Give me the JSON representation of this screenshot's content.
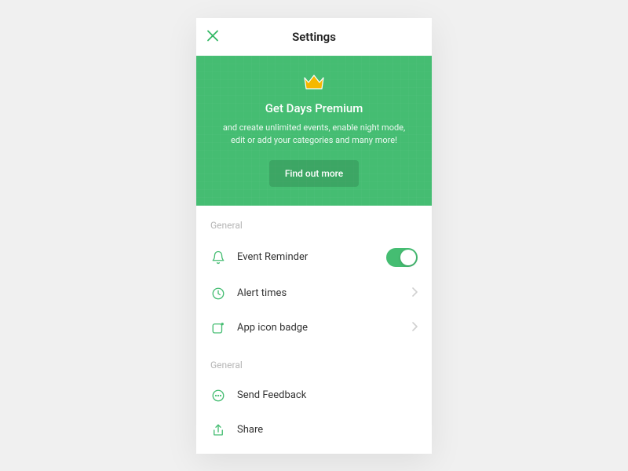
{
  "header": {
    "title": "Settings"
  },
  "premium": {
    "title": "Get Days Premium",
    "description": "and create unlimited events, enable night mode, edit or add your categories and many more!",
    "button": "Find out more"
  },
  "sections": [
    {
      "label": "General",
      "items": [
        {
          "icon": "bell",
          "label": "Event Reminder",
          "accessory": "toggle",
          "toggle_on": true
        },
        {
          "icon": "clock",
          "label": "Alert times",
          "accessory": "chevron"
        },
        {
          "icon": "badge",
          "label": "App icon badge",
          "accessory": "chevron"
        }
      ]
    },
    {
      "label": "General",
      "items": [
        {
          "icon": "chat",
          "label": "Send Feedback",
          "accessory": "none"
        },
        {
          "icon": "share",
          "label": "Share",
          "accessory": "none"
        }
      ]
    }
  ],
  "colors": {
    "accent": "#45bd72",
    "crown_fill": "#f5b800"
  }
}
